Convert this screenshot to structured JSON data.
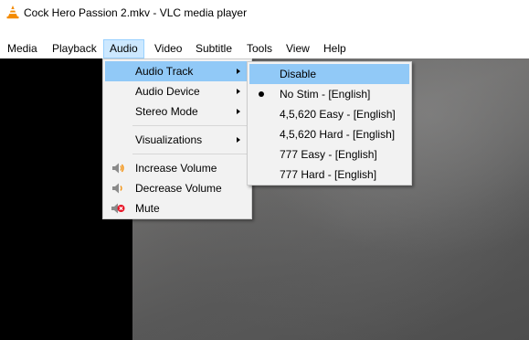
{
  "window": {
    "title": "Cock Hero Passion 2.mkv - VLC media player",
    "icon": "vlc-cone-icon"
  },
  "menubar": {
    "items": [
      {
        "label": "Media"
      },
      {
        "label": "Playback"
      },
      {
        "label": "Audio",
        "active": true
      },
      {
        "label": "Video"
      },
      {
        "label": "Subtitle"
      },
      {
        "label": "Tools"
      },
      {
        "label": "View"
      },
      {
        "label": "Help"
      }
    ]
  },
  "audio_menu": {
    "items": [
      {
        "label": "Audio Track",
        "submenu": true,
        "highlighted": true
      },
      {
        "label": "Audio Device",
        "submenu": true
      },
      {
        "label": "Stereo Mode",
        "submenu": true
      },
      {
        "label": "Visualizations",
        "submenu": true
      },
      {
        "label": "Increase Volume",
        "icon": "volume-up-icon"
      },
      {
        "label": "Decrease Volume",
        "icon": "volume-down-icon"
      },
      {
        "label": "Mute",
        "icon": "mute-icon"
      }
    ]
  },
  "audio_track_menu": {
    "items": [
      {
        "label": "Disable",
        "highlighted": true
      },
      {
        "label": "No Stim - [English]",
        "selected": true
      },
      {
        "label": "4,5,620 Easy - [English]"
      },
      {
        "label": "4,5,620 Hard - [English]"
      },
      {
        "label": "777 Easy - [English]"
      },
      {
        "label": "777 Hard - [English]"
      }
    ]
  },
  "colors": {
    "menu_bg": "#f2f2f2",
    "highlight": "#91c9f7",
    "menubar_active": "#cce8ff",
    "vlc_orange": "#f48b00",
    "mute_red": "#e81123"
  }
}
